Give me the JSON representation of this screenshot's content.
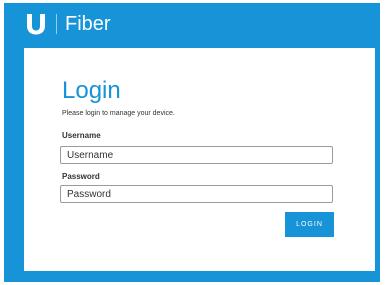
{
  "header": {
    "logo_icon": "ubiquiti-u-logo-icon",
    "product_name": "Fiber"
  },
  "login": {
    "title": "Login",
    "subtitle": "Please login to manage your device.",
    "username_label": "Username",
    "username_placeholder": "Username",
    "username_value": "",
    "password_label": "Password",
    "password_placeholder": "Password",
    "password_value": "",
    "submit_label": "LOGIN"
  },
  "colors": {
    "brand_blue": "#1793d7",
    "card_background": "#ffffff",
    "text": "#333333",
    "input_border": "#9b9b9b"
  }
}
